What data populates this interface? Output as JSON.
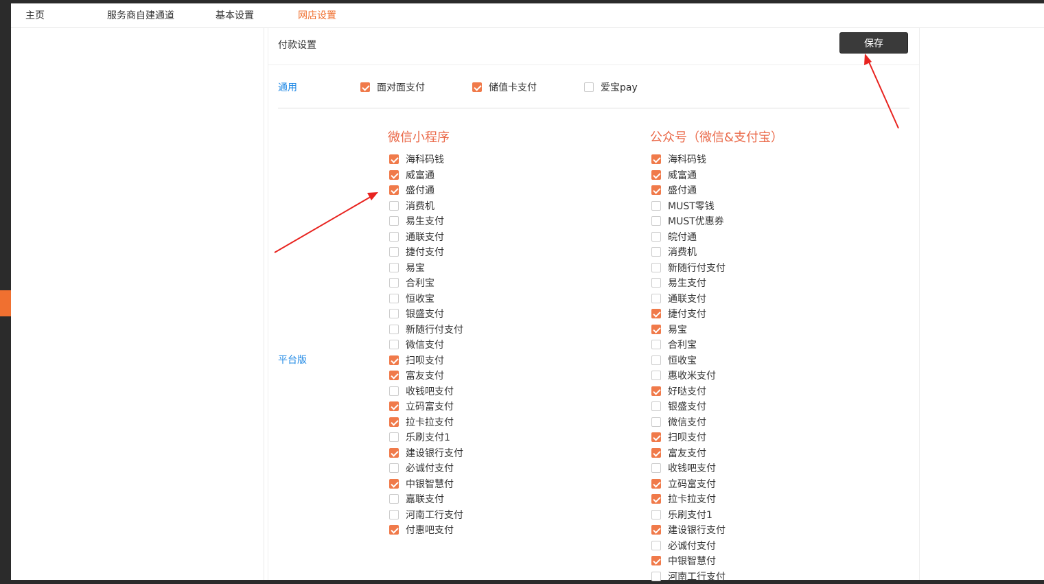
{
  "nav": {
    "items": [
      {
        "label": "主页",
        "active": false
      },
      {
        "label": "服务商自建通道",
        "active": false
      },
      {
        "label": "基本设置",
        "active": false
      },
      {
        "label": "网店设置",
        "active": true
      }
    ]
  },
  "panel": {
    "title": "付款设置",
    "save_label": "保存"
  },
  "general": {
    "label": "通用",
    "options": [
      {
        "label": "面对面支付",
        "checked": true
      },
      {
        "label": "储值卡支付",
        "checked": true
      },
      {
        "label": "爱宝pay",
        "checked": false
      }
    ]
  },
  "platform": {
    "label": "平台版",
    "miniprogram": {
      "title": "微信小程序",
      "items": [
        {
          "label": "海科码钱",
          "checked": true
        },
        {
          "label": "威富通",
          "checked": true
        },
        {
          "label": "盛付通",
          "checked": true
        },
        {
          "label": "消费机",
          "checked": false
        },
        {
          "label": "易生支付",
          "checked": false
        },
        {
          "label": "通联支付",
          "checked": false
        },
        {
          "label": "捷付支付",
          "checked": false
        },
        {
          "label": "易宝",
          "checked": false
        },
        {
          "label": "合利宝",
          "checked": false
        },
        {
          "label": "恒收宝",
          "checked": false
        },
        {
          "label": "银盛支付",
          "checked": false
        },
        {
          "label": "新随行付支付",
          "checked": false
        },
        {
          "label": "微信支付",
          "checked": false
        },
        {
          "label": "扫呗支付",
          "checked": true
        },
        {
          "label": "富友支付",
          "checked": true
        },
        {
          "label": "收钱吧支付",
          "checked": false
        },
        {
          "label": "立码富支付",
          "checked": true
        },
        {
          "label": "拉卡拉支付",
          "checked": true
        },
        {
          "label": "乐刷支付1",
          "checked": false
        },
        {
          "label": "建设银行支付",
          "checked": true
        },
        {
          "label": "必诚付支付",
          "checked": false
        },
        {
          "label": "中银智慧付",
          "checked": true
        },
        {
          "label": "嘉联支付",
          "checked": false
        },
        {
          "label": "河南工行支付",
          "checked": false
        },
        {
          "label": "付惠吧支付",
          "checked": true
        }
      ]
    },
    "official": {
      "title": "公众号（微信&支付宝）",
      "items": [
        {
          "label": "海科码钱",
          "checked": true
        },
        {
          "label": "威富通",
          "checked": true
        },
        {
          "label": "盛付通",
          "checked": true
        },
        {
          "label": "MUST零钱",
          "checked": false
        },
        {
          "label": "MUST优惠券",
          "checked": false
        },
        {
          "label": "皖付通",
          "checked": false
        },
        {
          "label": "消费机",
          "checked": false
        },
        {
          "label": "新随行付支付",
          "checked": false
        },
        {
          "label": "易生支付",
          "checked": false
        },
        {
          "label": "通联支付",
          "checked": false
        },
        {
          "label": "捷付支付",
          "checked": true
        },
        {
          "label": "易宝",
          "checked": true
        },
        {
          "label": "合利宝",
          "checked": false
        },
        {
          "label": "恒收宝",
          "checked": false
        },
        {
          "label": "惠收米支付",
          "checked": false
        },
        {
          "label": "好哒支付",
          "checked": true
        },
        {
          "label": "银盛支付",
          "checked": false
        },
        {
          "label": "微信支付",
          "checked": false
        },
        {
          "label": "扫呗支付",
          "checked": true
        },
        {
          "label": "富友支付",
          "checked": true
        },
        {
          "label": "收钱吧支付",
          "checked": false
        },
        {
          "label": "立码富支付",
          "checked": true
        },
        {
          "label": "拉卡拉支付",
          "checked": true
        },
        {
          "label": "乐刷支付1",
          "checked": false
        },
        {
          "label": "建设银行支付",
          "checked": true
        },
        {
          "label": "必诚付支付",
          "checked": false
        },
        {
          "label": "中银智慧付",
          "checked": true
        },
        {
          "label": "河南工行支付",
          "checked": false
        }
      ]
    }
  },
  "colors": {
    "accent": "#f07030",
    "checkbox": "#f07a4a",
    "section_title": "#ea6a4a",
    "link": "#1e88e5",
    "annotation_arrow": "#e8231f"
  }
}
